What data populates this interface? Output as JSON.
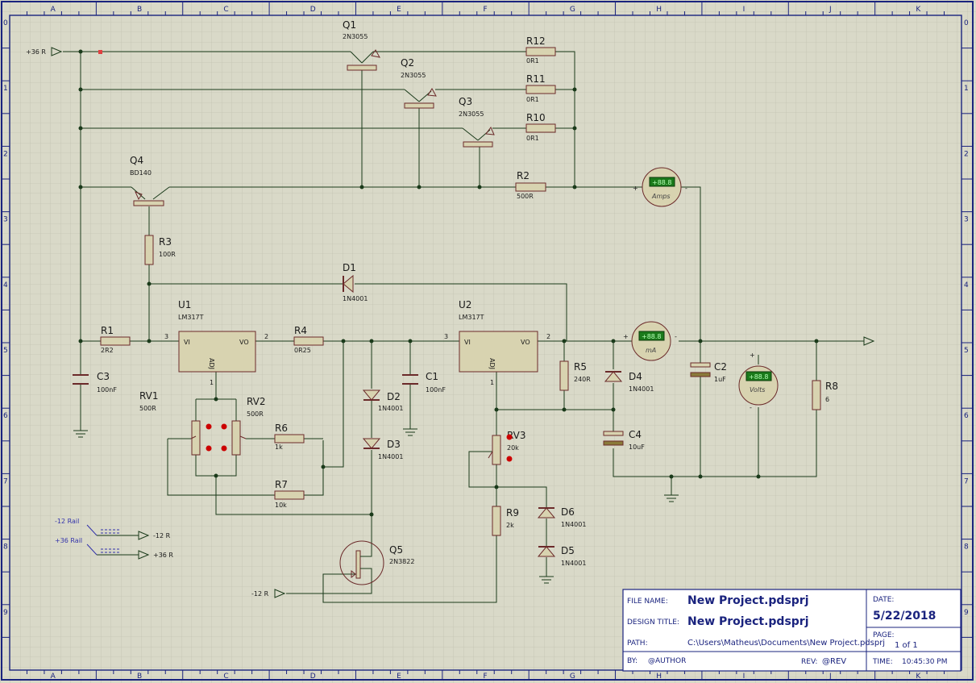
{
  "frame": {
    "columns": [
      "A",
      "B",
      "C",
      "D",
      "E",
      "F",
      "G",
      "H",
      "I",
      "J",
      "K"
    ],
    "rows": [
      "0",
      "1",
      "2",
      "3",
      "4",
      "5",
      "6",
      "7",
      "8",
      "9"
    ]
  },
  "components": {
    "q1": {
      "ref": "Q1",
      "value": "2N3055"
    },
    "q2": {
      "ref": "Q2",
      "value": "2N3055"
    },
    "q3": {
      "ref": "Q3",
      "value": "2N3055"
    },
    "q4": {
      "ref": "Q4",
      "value": "BD140"
    },
    "q5": {
      "ref": "Q5",
      "value": "2N3822"
    },
    "r1": {
      "ref": "R1",
      "value": "2R2"
    },
    "r2": {
      "ref": "R2",
      "value": "500R"
    },
    "r3": {
      "ref": "R3",
      "value": "100R"
    },
    "r4": {
      "ref": "R4",
      "value": "0R25"
    },
    "r5": {
      "ref": "R5",
      "value": "240R"
    },
    "r6": {
      "ref": "R6",
      "value": "1k"
    },
    "r7": {
      "ref": "R7",
      "value": "10k"
    },
    "r8": {
      "ref": "R8",
      "value": "6"
    },
    "r9": {
      "ref": "R9",
      "value": "2k"
    },
    "r10": {
      "ref": "R10",
      "value": "0R1"
    },
    "r11": {
      "ref": "R11",
      "value": "0R1"
    },
    "r12": {
      "ref": "R12",
      "value": "0R1"
    },
    "rv1": {
      "ref": "RV1",
      "value": "500R"
    },
    "rv2": {
      "ref": "RV2",
      "value": "500R"
    },
    "rv3": {
      "ref": "RV3",
      "value": "20k"
    },
    "c1": {
      "ref": "C1",
      "value": "100nF"
    },
    "c2": {
      "ref": "C2",
      "value": "1uF"
    },
    "c3": {
      "ref": "C3",
      "value": "100nF"
    },
    "c4": {
      "ref": "C4",
      "value": "10uF"
    },
    "d1": {
      "ref": "D1",
      "value": "1N4001"
    },
    "d2": {
      "ref": "D2",
      "value": "1N4001"
    },
    "d3": {
      "ref": "D3",
      "value": "1N4001"
    },
    "d4": {
      "ref": "D4",
      "value": "1N4001"
    },
    "d5": {
      "ref": "D5",
      "value": "1N4001"
    },
    "d6": {
      "ref": "D6",
      "value": "1N4001"
    },
    "u1": {
      "ref": "U1",
      "value": "LM317T",
      "vi": "VI",
      "vo": "VO",
      "adj": "ADJ",
      "pin_in": "3",
      "pin_out": "2",
      "pin_adj": "1"
    },
    "u2": {
      "ref": "U2",
      "value": "LM317T",
      "vi": "VI",
      "vo": "VO",
      "adj": "ADJ",
      "pin_in": "3",
      "pin_out": "2",
      "pin_adj": "1"
    }
  },
  "meters": {
    "amps": {
      "label": "Amps",
      "display": "+88.8"
    },
    "ma": {
      "label": "mA",
      "display": "+88.8"
    },
    "volts": {
      "label": "Volts",
      "display": "+88.8"
    }
  },
  "terminals": {
    "supply_in": "+36 R",
    "neg_in": "-12 R",
    "neg_out": "-12 R",
    "pos_out": "+36 R",
    "rail_neg": "-12 Rail",
    "rail_pos": "+36 Rail"
  },
  "title_block": {
    "file_name_label": "FILE NAME:",
    "file_name": "New Project.pdsprj",
    "design_title_label": "DESIGN TITLE:",
    "design_title": "New Project.pdsprj",
    "path_label": "PATH:",
    "path": "C:\\Users\\Matheus\\Documents\\New Project.pdsprj",
    "by_label": "BY:",
    "author": "@AUTHOR",
    "rev_label": "REV:",
    "rev": "@REV",
    "date_label": "DATE:",
    "date": "5/22/2018",
    "page_label": "PAGE:",
    "page": "1 of 1",
    "time_label": "TIME:",
    "time": "10:45:30 PM"
  },
  "colors": {
    "background": "#d9d9c8",
    "grid": "#c3c3b2",
    "wire": "#1a3a1a",
    "component_body": "#d8d3b0",
    "component_stroke": "#6b2a2a",
    "text": "#1a1a1a",
    "frame": "#1a237e",
    "probe": "#cc0000",
    "meter_lcd": "#1b7a1b"
  }
}
